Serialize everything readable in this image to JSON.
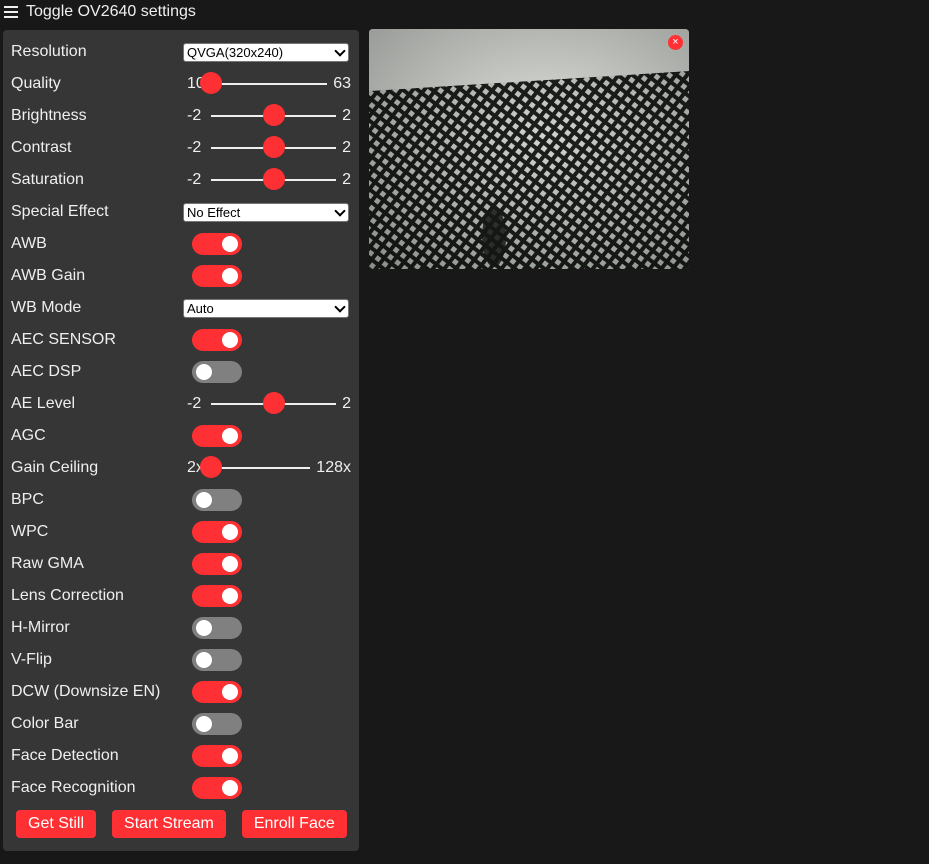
{
  "header": {
    "title": "Toggle OV2640 settings",
    "menu_icon": "hamburger-icon"
  },
  "settings": {
    "resolution": {
      "label": "Resolution",
      "value": "QVGA(320x240)"
    },
    "quality": {
      "label": "Quality",
      "min": "10",
      "max": "63",
      "fraction": 0.0
    },
    "brightness": {
      "label": "Brightness",
      "min": "-2",
      "max": "2",
      "fraction": 0.5
    },
    "contrast": {
      "label": "Contrast",
      "min": "-2",
      "max": "2",
      "fraction": 0.5
    },
    "saturation": {
      "label": "Saturation",
      "min": "-2",
      "max": "2",
      "fraction": 0.5
    },
    "special_effect": {
      "label": "Special Effect",
      "value": "No Effect"
    },
    "awb": {
      "label": "AWB",
      "on": true
    },
    "awb_gain": {
      "label": "AWB Gain",
      "on": true
    },
    "wb_mode": {
      "label": "WB Mode",
      "value": "Auto"
    },
    "aec_sensor": {
      "label": "AEC SENSOR",
      "on": true
    },
    "aec_dsp": {
      "label": "AEC DSP",
      "on": false
    },
    "ae_level": {
      "label": "AE Level",
      "min": "-2",
      "max": "2",
      "fraction": 0.5
    },
    "agc": {
      "label": "AGC",
      "on": true
    },
    "gain_ceiling": {
      "label": "Gain Ceiling",
      "min": "2x",
      "max": "128x",
      "fraction": 0.0
    },
    "bpc": {
      "label": "BPC",
      "on": false
    },
    "wpc": {
      "label": "WPC",
      "on": true
    },
    "raw_gma": {
      "label": "Raw GMA",
      "on": true
    },
    "lens_correction": {
      "label": "Lens Correction",
      "on": true
    },
    "h_mirror": {
      "label": "H-Mirror",
      "on": false
    },
    "v_flip": {
      "label": "V-Flip",
      "on": false
    },
    "dcw": {
      "label": "DCW (Downsize EN)",
      "on": true
    },
    "color_bar": {
      "label": "Color Bar",
      "on": false
    },
    "face_detection": {
      "label": "Face Detection",
      "on": true
    },
    "face_recognition": {
      "label": "Face Recognition",
      "on": true
    }
  },
  "buttons": {
    "get_still": "Get Still",
    "start_stream": "Start Stream",
    "enroll_face": "Enroll Face"
  },
  "stream": {
    "close_label": "×"
  },
  "colors": {
    "accent": "#ff3034",
    "panel": "#363636",
    "background": "#181818",
    "toggle_off": "#808080"
  }
}
